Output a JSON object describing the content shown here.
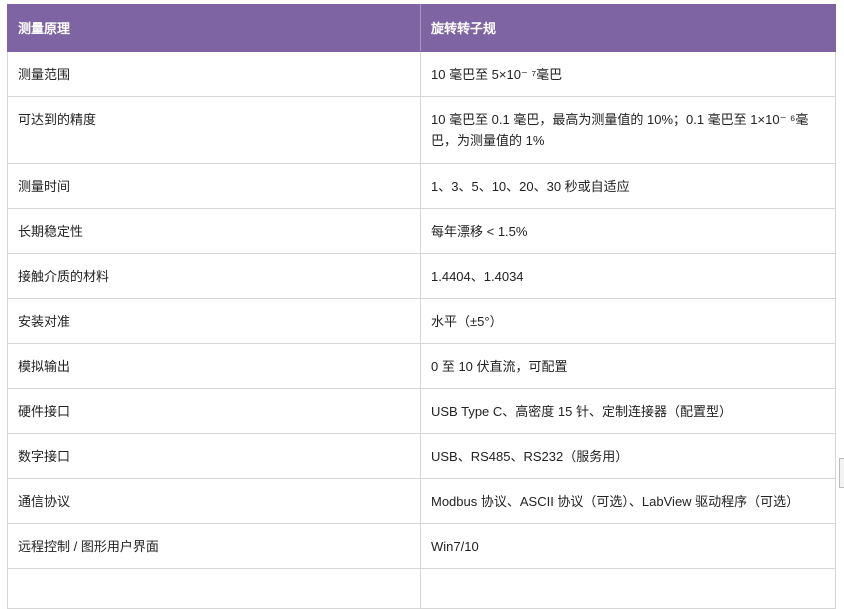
{
  "table": {
    "headers": [
      "测量原理",
      "旋转转子规"
    ],
    "rows": [
      [
        "测量范围",
        "10 毫巴至 5×10⁻ ⁷毫巴"
      ],
      [
        "可达到的精度",
        "10 毫巴至 0.1 毫巴，最高为测量值的 10%；0.1 毫巴至 1×10⁻ ⁶毫巴，为测量值的 1%"
      ],
      [
        "测量时间",
        "1、3、5、10、20、30 秒或自适应"
      ],
      [
        "长期稳定性",
        "每年漂移 < 1.5%"
      ],
      [
        "接触介质的材料",
        "1.4404、1.4034"
      ],
      [
        "安装对准",
        "水平（±5°）"
      ],
      [
        "模拟输出",
        "0 至 10 伏直流，可配置"
      ],
      [
        "硬件接口",
        "USB Type C、高密度 15 针、定制连接器（配置型）"
      ],
      [
        "数字接口",
        "USB、RS485、RS232（服务用）"
      ],
      [
        "通信协议",
        "Modbus 协议、ASCII 协议（可选）、LabView 驱动程序（可选）"
      ],
      [
        "远程控制 / 图形用户界面",
        "Win7/10"
      ],
      [
        "",
        ""
      ]
    ]
  }
}
